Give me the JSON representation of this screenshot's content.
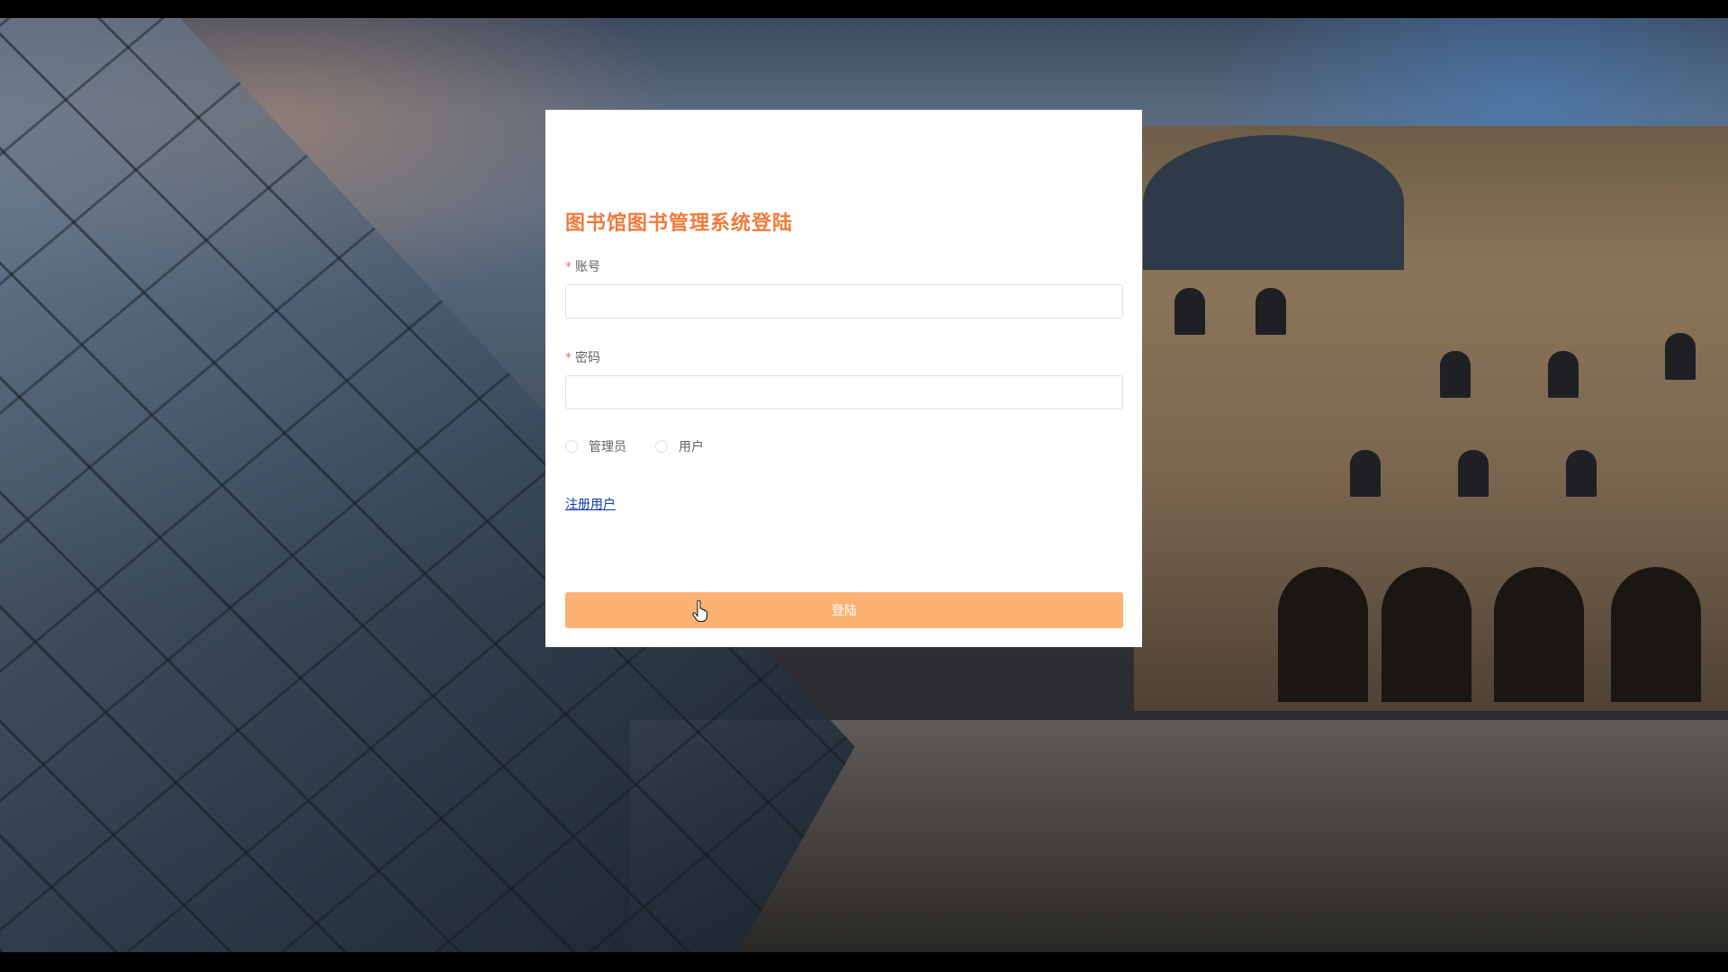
{
  "login_form": {
    "title": "图书馆图书管理系统登陆",
    "account": {
      "required_mark": "*",
      "label": "账号",
      "value": "",
      "placeholder": ""
    },
    "password": {
      "required_mark": "*",
      "label": "密码",
      "value": "",
      "placeholder": ""
    },
    "role_options": [
      {
        "label": "管理员",
        "selected": false
      },
      {
        "label": "用户",
        "selected": false
      }
    ],
    "register_link": "注册用户",
    "login_button": "登陆"
  },
  "colors": {
    "title": "#ef7a3a",
    "login_button_bg": "#fbb273",
    "required_mark": "#f56c6c",
    "link": "#0b3aa8"
  },
  "icons": {
    "cursor": "hand-pointer-icon"
  }
}
